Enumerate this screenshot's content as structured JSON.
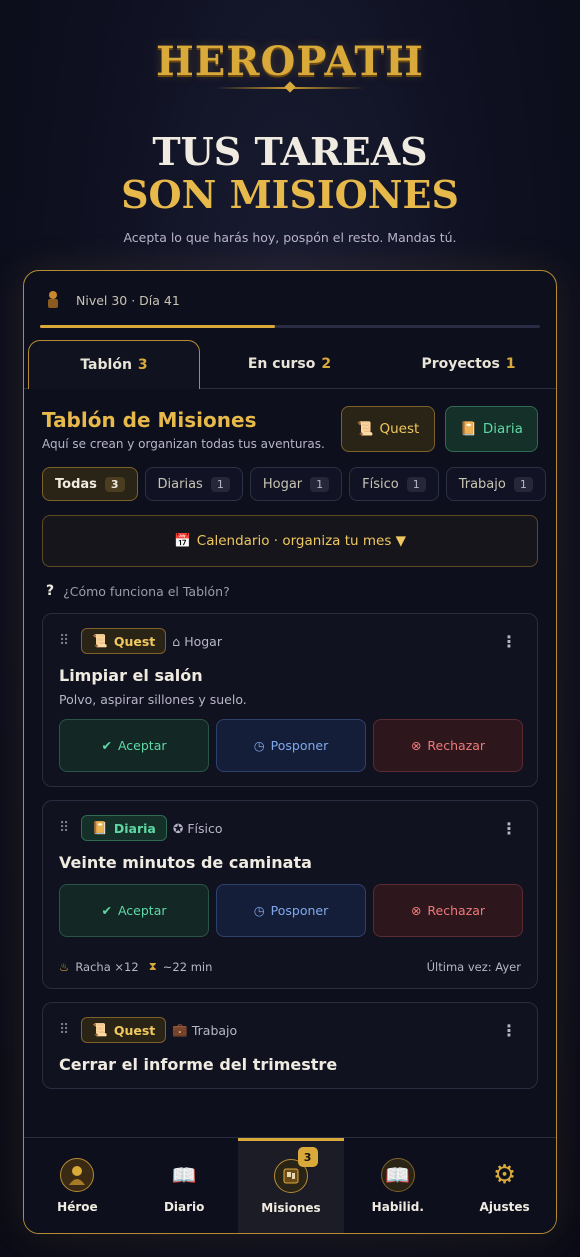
{
  "brand": {
    "logo": "HEROPATH"
  },
  "hero": {
    "title_line1": "TUS TAREAS",
    "title_line2": "SON MISIONES",
    "subtitle": "Acepta lo que harás hoy, pospón el resto. Mandas tú."
  },
  "status": {
    "level_text": "Nivel 30 · Día 41",
    "progress_fraction": 0.47
  },
  "tabs": [
    {
      "label": "Tablón",
      "count": "3"
    },
    {
      "label": "En curso",
      "count": "2"
    },
    {
      "label": "Proyectos",
      "count": "1"
    }
  ],
  "board": {
    "title": "Tablón de Misiones",
    "subtitle": "Aquí se crean y organizan todas tus aventuras.",
    "quest_button": "Quest",
    "diaria_button": "Diaria"
  },
  "filters": [
    {
      "label": "Todas",
      "count": "3"
    },
    {
      "label": "Diarias",
      "count": "1"
    },
    {
      "label": "Hogar",
      "count": "1"
    },
    {
      "label": "Físico",
      "count": "1"
    },
    {
      "label": "Trabajo",
      "count": "1"
    }
  ],
  "calendar": {
    "label": "Calendario · organiza tu mes ▼"
  },
  "help": {
    "q": "?",
    "label": "¿Cómo funciona el Tablón?"
  },
  "cards": [
    {
      "tag": "Quest",
      "category": "Hogar",
      "title": "Limpiar el salón",
      "description": "Polvo, aspirar sillones y suelo.",
      "accept": "Aceptar",
      "postpone": "Posponer",
      "reject": "Rechazar"
    },
    {
      "tag": "Diaria",
      "category": "Físico",
      "title": "Veinte minutos de caminata",
      "accept": "Aceptar",
      "postpone": "Posponer",
      "reject": "Rechazar",
      "streak": "Racha ×12",
      "duration": "~22 min",
      "last": "Última vez: Ayer"
    },
    {
      "tag": "Quest",
      "category": "Trabajo",
      "title": "Cerrar el informe del trimestre"
    }
  ],
  "nav": [
    {
      "label": "Héroe",
      "icon": "hero-icon"
    },
    {
      "label": "Diario",
      "icon": "book-icon"
    },
    {
      "label": "Misiones",
      "icon": "quest-board-icon",
      "badge": "3"
    },
    {
      "label": "Habilid.",
      "icon": "skills-icon"
    },
    {
      "label": "Ajustes",
      "icon": "gear-icon"
    }
  ],
  "colors": {
    "gold": "#d9a93a",
    "green": "#5ed9a5",
    "blue": "#7fa8ec",
    "red": "#ee7a7a"
  }
}
